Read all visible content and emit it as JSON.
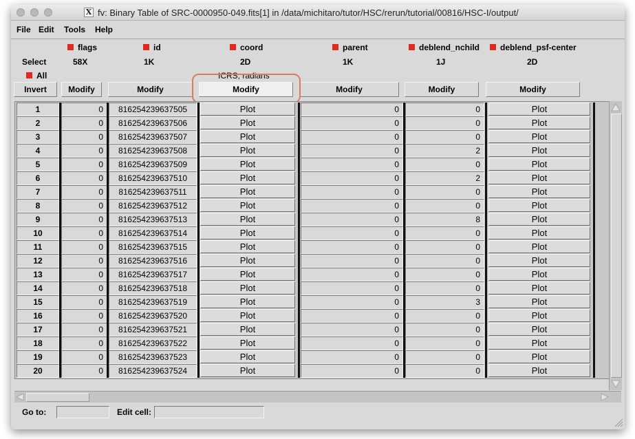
{
  "window": {
    "title": "fv: Binary Table of SRC-0000950-049.fits[1] in /data/michitaro/tutor/HSC/rerun/tutorial/00816/HSC-I/output/",
    "x11_glyph": "X"
  },
  "menu": [
    "File",
    "Edit",
    "Tools",
    "Help"
  ],
  "header": {
    "select_label": "Select",
    "all_label": "All",
    "invert_label": "Invert",
    "columns": [
      {
        "name": "flags",
        "format": "58X",
        "unit": "",
        "modify": "Modify"
      },
      {
        "name": "id",
        "format": "1K",
        "unit": "",
        "modify": "Modify"
      },
      {
        "name": "coord",
        "format": "2D",
        "unit": "ICRS; radians",
        "modify": "Modify"
      },
      {
        "name": "parent",
        "format": "1K",
        "unit": "",
        "modify": "Modify"
      },
      {
        "name": "deblend_nchild",
        "format": "1J",
        "unit": "",
        "modify": "Modify"
      },
      {
        "name": "deblend_psf-center",
        "format": "2D",
        "unit": "",
        "modify": "Modify"
      }
    ]
  },
  "plot_label": "Plot",
  "rows": [
    {
      "n": "1",
      "flags": "0",
      "id": "816254239637505",
      "parent": "0",
      "nchild": "0"
    },
    {
      "n": "2",
      "flags": "0",
      "id": "816254239637506",
      "parent": "0",
      "nchild": "0"
    },
    {
      "n": "3",
      "flags": "0",
      "id": "816254239637507",
      "parent": "0",
      "nchild": "0"
    },
    {
      "n": "4",
      "flags": "0",
      "id": "816254239637508",
      "parent": "0",
      "nchild": "2"
    },
    {
      "n": "5",
      "flags": "0",
      "id": "816254239637509",
      "parent": "0",
      "nchild": "0"
    },
    {
      "n": "6",
      "flags": "0",
      "id": "816254239637510",
      "parent": "0",
      "nchild": "2"
    },
    {
      "n": "7",
      "flags": "0",
      "id": "816254239637511",
      "parent": "0",
      "nchild": "0"
    },
    {
      "n": "8",
      "flags": "0",
      "id": "816254239637512",
      "parent": "0",
      "nchild": "0"
    },
    {
      "n": "9",
      "flags": "0",
      "id": "816254239637513",
      "parent": "0",
      "nchild": "8"
    },
    {
      "n": "10",
      "flags": "0",
      "id": "816254239637514",
      "parent": "0",
      "nchild": "0"
    },
    {
      "n": "11",
      "flags": "0",
      "id": "816254239637515",
      "parent": "0",
      "nchild": "0"
    },
    {
      "n": "12",
      "flags": "0",
      "id": "816254239637516",
      "parent": "0",
      "nchild": "0"
    },
    {
      "n": "13",
      "flags": "0",
      "id": "816254239637517",
      "parent": "0",
      "nchild": "0"
    },
    {
      "n": "14",
      "flags": "0",
      "id": "816254239637518",
      "parent": "0",
      "nchild": "0"
    },
    {
      "n": "15",
      "flags": "0",
      "id": "816254239637519",
      "parent": "0",
      "nchild": "3"
    },
    {
      "n": "16",
      "flags": "0",
      "id": "816254239637520",
      "parent": "0",
      "nchild": "0"
    },
    {
      "n": "17",
      "flags": "0",
      "id": "816254239637521",
      "parent": "0",
      "nchild": "0"
    },
    {
      "n": "18",
      "flags": "0",
      "id": "816254239637522",
      "parent": "0",
      "nchild": "0"
    },
    {
      "n": "19",
      "flags": "0",
      "id": "816254239637523",
      "parent": "0",
      "nchild": "0"
    },
    {
      "n": "20",
      "flags": "0",
      "id": "816254239637524",
      "parent": "0",
      "nchild": "0"
    }
  ],
  "footer": {
    "goto_label": "Go to:",
    "goto_value": "",
    "editcell_label": "Edit cell:",
    "editcell_value": ""
  },
  "colors": {
    "select_marker": "#e12a1f",
    "highlight": "#d97b63"
  }
}
